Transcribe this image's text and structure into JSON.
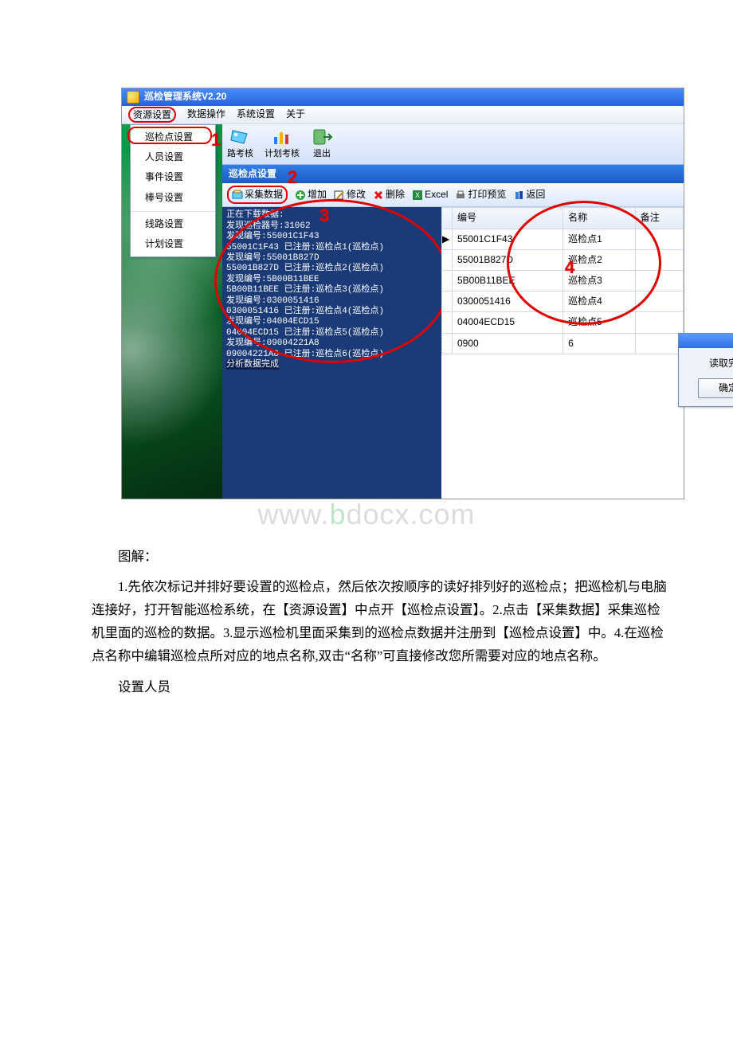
{
  "title": "巡检管理系统V2.20",
  "menubar": [
    "资源设置",
    "数据操作",
    "系统设置",
    "关于"
  ],
  "dropdown": [
    "巡检点设置",
    "人员设置",
    "事件设置",
    "棒号设置",
    "线路设置",
    "计划设置"
  ],
  "toolbar_main": {
    "btn1": "路考核",
    "btn2": "计划考核",
    "btn3": "退出"
  },
  "sub_title": "巡检点设置",
  "sub_toolbar": {
    "collect": "采集数据",
    "add": "增加",
    "edit": "修改",
    "del": "删除",
    "excel": "Excel",
    "print": "打印预览",
    "back": "返回"
  },
  "log_lines": [
    "正在下载数据:",
    "发现巡检器号:31062",
    "发现编号:55001C1F43",
    "55001C1F43 已注册:巡检点1(巡检点)",
    "发现编号:55001B827D",
    "55001B827D 已注册:巡检点2(巡检点)",
    "发现编号:5B00B11BEE",
    "5B00B11BEE 已注册:巡检点3(巡检点)",
    "发现编号:0300051416",
    "0300051416 已注册:巡检点4(巡检点)",
    "发现编号:04004ECD15",
    "04004ECD15 已注册:巡检点5(巡检点)",
    "发现编号:09004221A8",
    "09004221A8 已注册:巡检点6(巡检点)",
    "分析数据完成"
  ],
  "grid": {
    "headers": {
      "no": "编号",
      "name": "名称",
      "remark": "备注"
    },
    "rows": [
      {
        "no": "55001C1F43",
        "name": "巡检点1",
        "remark": ""
      },
      {
        "no": "55001B827D",
        "name": "巡检点2",
        "remark": ""
      },
      {
        "no": "5B00B11BEE",
        "name": "巡检点3",
        "remark": ""
      },
      {
        "no": "0300051416",
        "name": "巡检点4",
        "remark": ""
      },
      {
        "no": "04004ECD15",
        "name": "巡检点5",
        "remark": ""
      },
      {
        "no": "0900",
        "name": "6",
        "remark": ""
      }
    ]
  },
  "modal": {
    "text": "读取完成",
    "ok": "确定"
  },
  "red_nums": {
    "n1": "1",
    "n2": "2",
    "n3": "3",
    "n4": "4"
  },
  "watermark_left": "www.",
  "watermark_mid": "b",
  "watermark_right": "docx.com",
  "doc": {
    "p0": "图解：",
    "p1": "1.先依次标记并排好要设置的巡检点，然后依次按顺序的读好排列好的巡检点；把巡检机与电脑连接好，打开智能巡检系统，在【资源设置】中点开【巡检点设置】。2.点击【采集数据】采集巡检机里面的巡检的数据。3.显示巡检机里面采集到的巡检点数据并注册到【巡检点设置】中。4.在巡检点名称中编辑巡检点所对应的地点名称,双击“名称”可直接修改您所需要对应的地点名称。",
    "p2": "设置人员"
  }
}
